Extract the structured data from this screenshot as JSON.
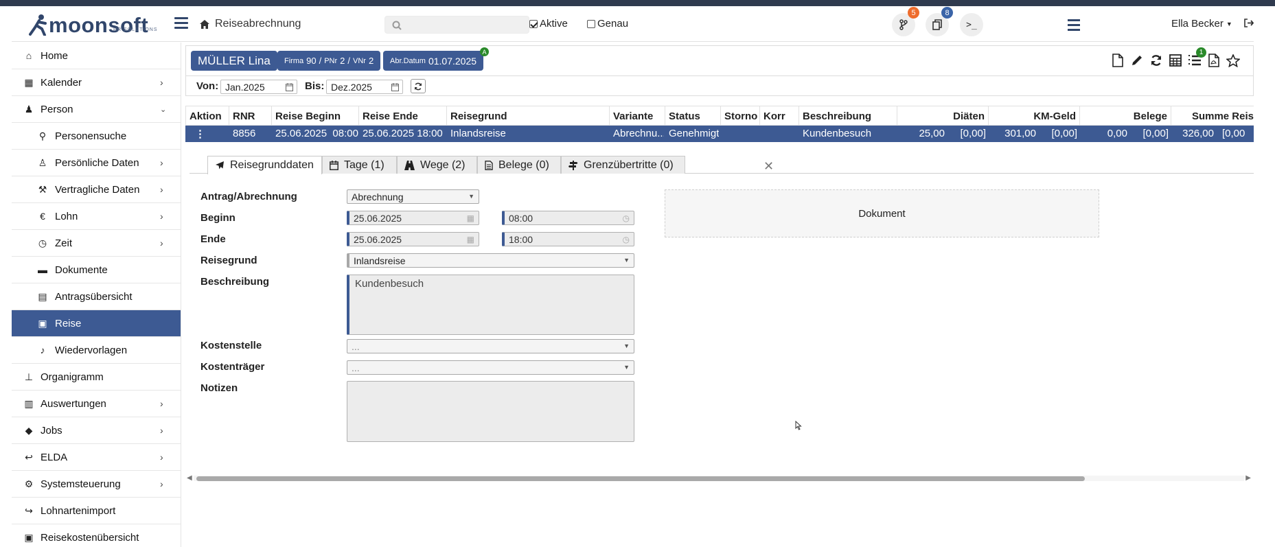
{
  "header": {
    "brand": "moonsoft",
    "brand_sub": "HR SOLUTIONS",
    "breadcrumb": "Reiseabrechnung",
    "search_placeholder": "",
    "filter_aktive": "Aktive",
    "filter_genau": "Genau",
    "badge_branch": "5",
    "badge_docs": "8",
    "terminal_label": ">_",
    "user": "Ella Becker"
  },
  "sidebar": {
    "items": [
      {
        "label": "Home",
        "icon": "home-icon"
      },
      {
        "label": "Kalender",
        "icon": "calendar-icon"
      },
      {
        "label": "Person",
        "icon": "person-icon"
      },
      {
        "label": "Personensuche",
        "icon": "search-icon"
      },
      {
        "label": "Persönliche Daten",
        "icon": "male-icon"
      },
      {
        "label": "Vertragliche Daten",
        "icon": "gavel-icon"
      },
      {
        "label": "Lohn",
        "icon": "euro-icon"
      },
      {
        "label": "Zeit",
        "icon": "clock-icon"
      },
      {
        "label": "Dokumente",
        "icon": "archive-icon"
      },
      {
        "label": "Antragsübersicht",
        "icon": "book-icon"
      },
      {
        "label": "Reise",
        "icon": "suitcase-icon"
      },
      {
        "label": "Wiedervorlagen",
        "icon": "bell-icon"
      },
      {
        "label": "Organigramm",
        "icon": "sitemap-icon"
      },
      {
        "label": "Auswertungen",
        "icon": "report-icon"
      },
      {
        "label": "Jobs",
        "icon": "tags-icon"
      },
      {
        "label": "ELDA",
        "icon": "reply-icon"
      },
      {
        "label": "Systemsteuerung",
        "icon": "cog-icon"
      },
      {
        "label": "Lohnartenimport",
        "icon": "share-icon"
      },
      {
        "label": "Reisekostenübersicht",
        "icon": "suitcase-icon"
      }
    ]
  },
  "employee": {
    "name": "MÜLLER Lina",
    "firma_lbl": "Firma",
    "firma": "90",
    "pnr_lbl": "PNr",
    "pnr": "2",
    "vnr_lbl": "VNr",
    "vnr": "2",
    "abr_lbl": "Abr.Datum",
    "abr": "01.07.2025",
    "abr_flag": "A",
    "list_badge": "1"
  },
  "range": {
    "von_label": "Von:",
    "von": "Jan.2025",
    "bis_label": "Bis:",
    "bis": "Dez.2025"
  },
  "table": {
    "headers": [
      "Aktion",
      "RNR",
      "Reise Beginn",
      "Reise Ende",
      "Reisegrund",
      "Variante",
      "Status",
      "Storno",
      "Korr",
      "Beschreibung",
      "Diäten",
      "KM-Geld",
      "Belege",
      "Summe Reis"
    ],
    "row": {
      "rnr": "8856",
      "beginn": "25.06.2025  08:00",
      "ende": "25.06.2025 18:00",
      "grund": "Inlandsreise",
      "variante": "Abrechnu...",
      "status": "Genehmigt",
      "beschreibung": "Kundenbesuch",
      "diaeten": "25,00",
      "diaeten_k": "[0,00]",
      "km": "301,00",
      "km_k": "[0,00]",
      "belege": "0,00",
      "belege_k": "[0,00]",
      "summe": "326,00",
      "summe_k": "[0,00"
    }
  },
  "tabs": [
    {
      "label": "Reisegrunddaten"
    },
    {
      "label": "Tage (1)"
    },
    {
      "label": "Wege (2)"
    },
    {
      "label": "Belege (0)"
    },
    {
      "label": "Grenzübertritte (0)"
    }
  ],
  "form": {
    "antrag_label": "Antrag/Abrechnung",
    "antrag_value": "Abrechnung",
    "beginn_label": "Beginn",
    "beginn_date": "25.06.2025",
    "beginn_time": "08:00",
    "ende_label": "Ende",
    "ende_date": "25.06.2025",
    "ende_time": "18:00",
    "grund_label": "Reisegrund",
    "grund_value": "Inlandsreise",
    "beschreibung_label": "Beschreibung",
    "beschreibung_value": "Kundenbesuch",
    "kostenstelle_label": "Kostenstelle",
    "kostenstelle_value": "...",
    "kostentraeger_label": "Kostenträger",
    "kostentraeger_value": "...",
    "notizen_label": "Notizen",
    "notizen_value": "",
    "dokument": "Dokument"
  },
  "colors": {
    "primary": "#3d5a93",
    "topstrip": "#2f3a4e",
    "badge_orange": "#ee6c2c",
    "badge_green": "#2a8a2a"
  }
}
